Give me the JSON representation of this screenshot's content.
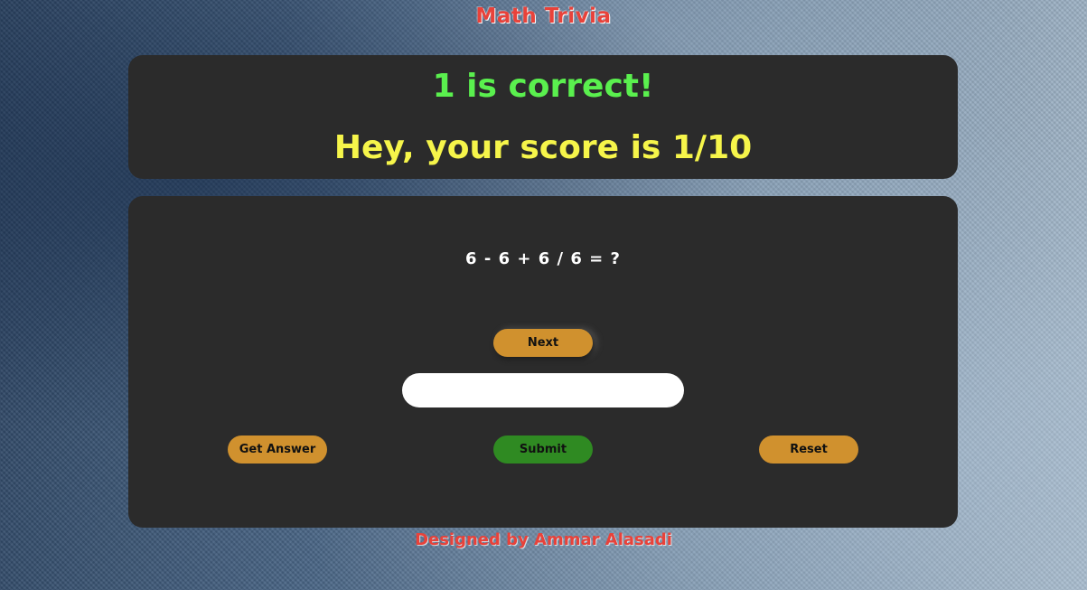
{
  "header": {
    "title": "Math Trivia"
  },
  "result": {
    "feedback": "1 is correct!",
    "score_message": "Hey, your score is 1/10"
  },
  "quiz": {
    "question": "6 - 6 + 6 / 6 = ?",
    "next_label": "Next",
    "answer_value": "",
    "answer_placeholder": "",
    "get_answer_label": "Get Answer",
    "submit_label": "Submit",
    "reset_label": "Reset"
  },
  "footer": {
    "credit": "Designed by Ammar Alasadi"
  },
  "colors": {
    "panel_bg": "#2b2b2b",
    "correct_green": "#5af04e",
    "score_yellow": "#f6f54a",
    "button_orange": "#d0912e",
    "submit_green": "#2f8a22",
    "title_red": "#e8423a"
  }
}
